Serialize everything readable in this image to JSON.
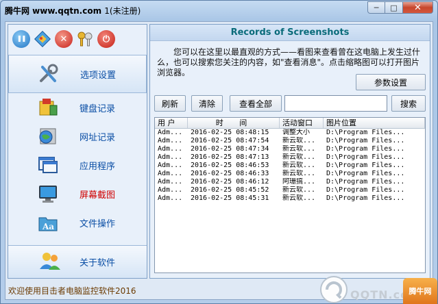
{
  "window": {
    "title_watermark": "腾牛网 www.qqtn.com",
    "title_rest": "1(未注册)",
    "min_glyph": "─",
    "max_glyph": "□",
    "close_glyph": "✕"
  },
  "toolbar": {
    "icons": [
      "pause-icon",
      "diamond-icon",
      "stop-icon",
      "keys-icon",
      "power-icon"
    ],
    "stop_glyph": "✕",
    "power_glyph": "⏻",
    "pause_glyph": "❚❚"
  },
  "nav": {
    "settings": "选项设置",
    "keyboard": "键盘记录",
    "urls": "网址记录",
    "apps": "应用程序",
    "screenshots": "屏幕截图",
    "files": "文件操作",
    "about": "关于软件"
  },
  "status": {
    "welcome": "欢迎使用目击者电脑监控软件2016"
  },
  "panel": {
    "title": "Records of Screenshots",
    "description": "您可以在这里以最直观的方式——看图来查看曾在这电脑上发生过什么，也可以搜索您关注的内容，如\"查看消息\"。点击缩略图可以打开图片浏览器。",
    "params_button": "参数设置",
    "refresh_button": "刷新",
    "clear_button": "清除",
    "view_all_button": "查看全部",
    "search_button": "搜索",
    "search_value": ""
  },
  "table": {
    "columns": [
      "用 户",
      "时 间",
      "活动窗口",
      "图片位置"
    ],
    "rows": [
      [
        "Adm...",
        "2016-02-25 08:48:15",
        "调整大小",
        "D:\\Program Files..."
      ],
      [
        "Adm...",
        "2016-02-25 08:47:54",
        "新云软...",
        "D:\\Program Files..."
      ],
      [
        "Adm...",
        "2016-02-25 08:47:34",
        "新云软...",
        "D:\\Program Files..."
      ],
      [
        "Adm...",
        "2016-02-25 08:47:13",
        "新云软...",
        "D:\\Program Files..."
      ],
      [
        "Adm...",
        "2016-02-25 08:46:53",
        "新云软...",
        "D:\\Program Files..."
      ],
      [
        "Adm...",
        "2016-02-25 08:46:33",
        "新云软...",
        "D:\\Program Files..."
      ],
      [
        "Adm...",
        "2016-02-25 08:46:12",
        "阿珊搞...",
        "D:\\Program Files..."
      ],
      [
        "Adm...",
        "2016-02-25 08:45:52",
        "新云软...",
        "D:\\Program Files..."
      ],
      [
        "Adm...",
        "2016-02-25 08:45:31",
        "新云软...",
        "D:\\Program Files..."
      ]
    ]
  },
  "watermark": {
    "badge": "腾牛网",
    "logo": "QQTN.com"
  },
  "colors": {
    "title_teal": "#0a6b7a",
    "nav_blue": "#0a4ea5",
    "nav_active_red": "#d00000",
    "status_brown": "#6b3a00"
  }
}
